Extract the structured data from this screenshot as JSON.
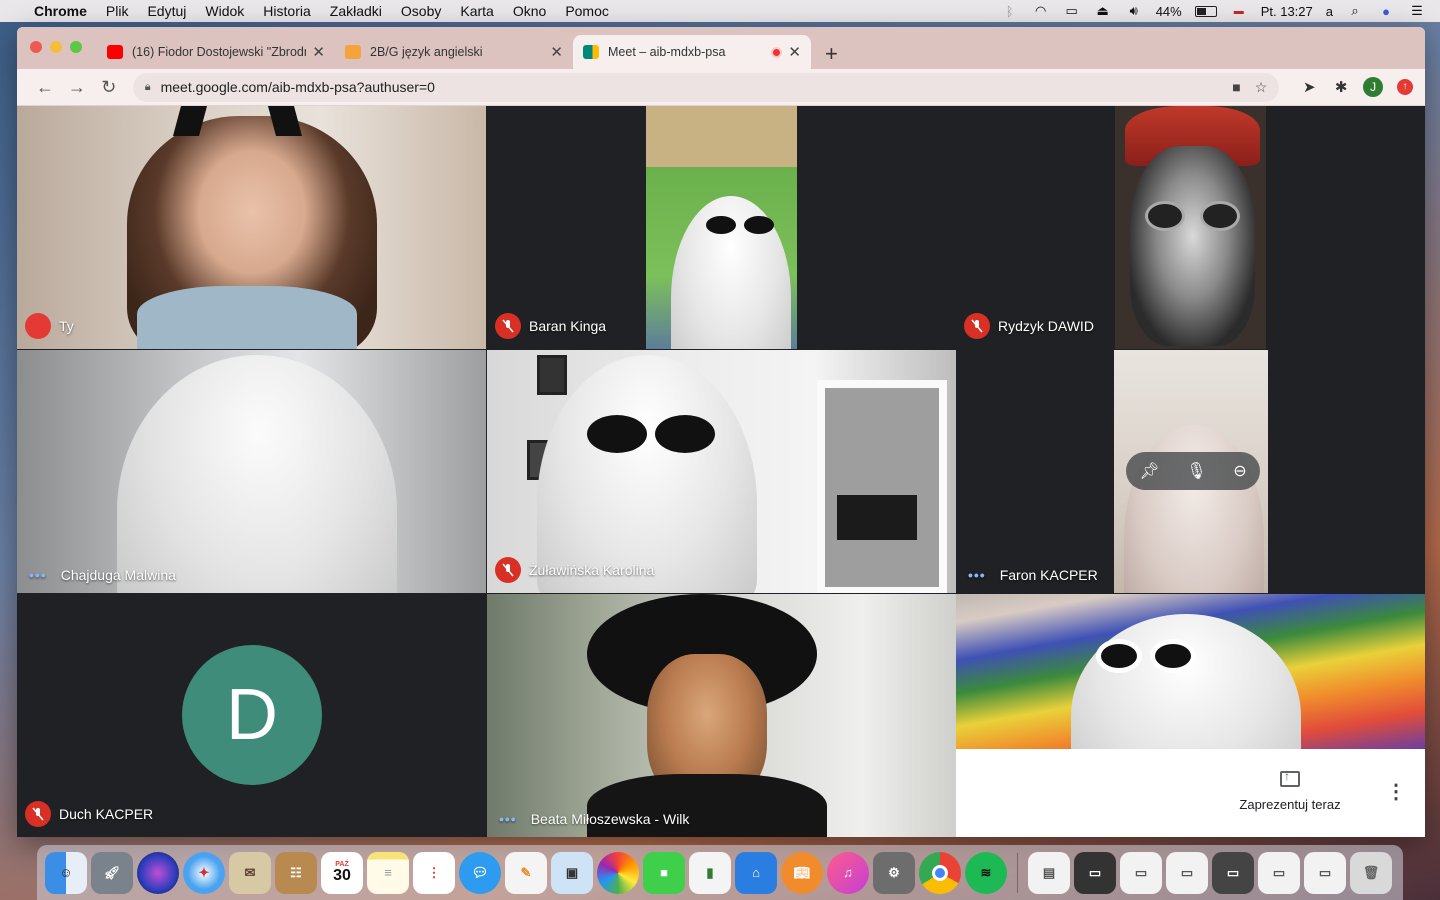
{
  "menubar": {
    "app_name": "Chrome",
    "items": [
      "Plik",
      "Edytuj",
      "Widok",
      "Historia",
      "Zakładki",
      "Osoby",
      "Karta",
      "Okno",
      "Pomoc"
    ],
    "battery": "44%",
    "clock": "Pt. 13:27",
    "user_letter": "a"
  },
  "tabs": [
    {
      "title": "(16) Fiodor Dostojewski \"Zbrodnia",
      "favicon_color": "#ff0000",
      "icon": "youtube-icon"
    },
    {
      "title": "2B/G język angielski",
      "favicon_color": "#f4a43a",
      "icon": "classroom-icon"
    },
    {
      "title": "Meet – aib-mdxb-psa",
      "favicon_color": "#00897b",
      "icon": "meet-icon"
    }
  ],
  "address_bar": {
    "url": "meet.google.com/aib-mdxb-psa?authuser=0",
    "profile_letter": "J"
  },
  "participants": [
    {
      "name": "Ty",
      "status": "self"
    },
    {
      "name": "Baran Kinga",
      "status": "muted"
    },
    {
      "name": "Rydzyk DAWID",
      "status": "muted"
    },
    {
      "name": "Chajduga Malwina",
      "status": "speaking"
    },
    {
      "name": "Żuławińska Karolina",
      "status": "muted"
    },
    {
      "name": "Faron KACPER",
      "status": "speaking"
    },
    {
      "name": "Duch KACPER",
      "status": "muted",
      "avatar_letter": "D"
    },
    {
      "name": "Beata Miłoszewska - Wilk",
      "status": "speaking"
    }
  ],
  "present_now": "Zaprezentuj teraz",
  "colors": {
    "meet_background": "#202124",
    "mic_off_red": "#d93025",
    "avatar_teal": "#3f8c7a",
    "tab_strip": "#dcc3c0"
  },
  "dock": {
    "calendar_month": "PAŹ",
    "calendar_day": "30",
    "apps": [
      "finder",
      "launchpad",
      "siri",
      "safari",
      "mail",
      "contacts",
      "calendar",
      "notes",
      "reminders",
      "messages",
      "pages",
      "preview",
      "photos",
      "facetime",
      "numbers",
      "keynote",
      "books",
      "music",
      "system-preferences",
      "chrome",
      "spotify"
    ]
  }
}
